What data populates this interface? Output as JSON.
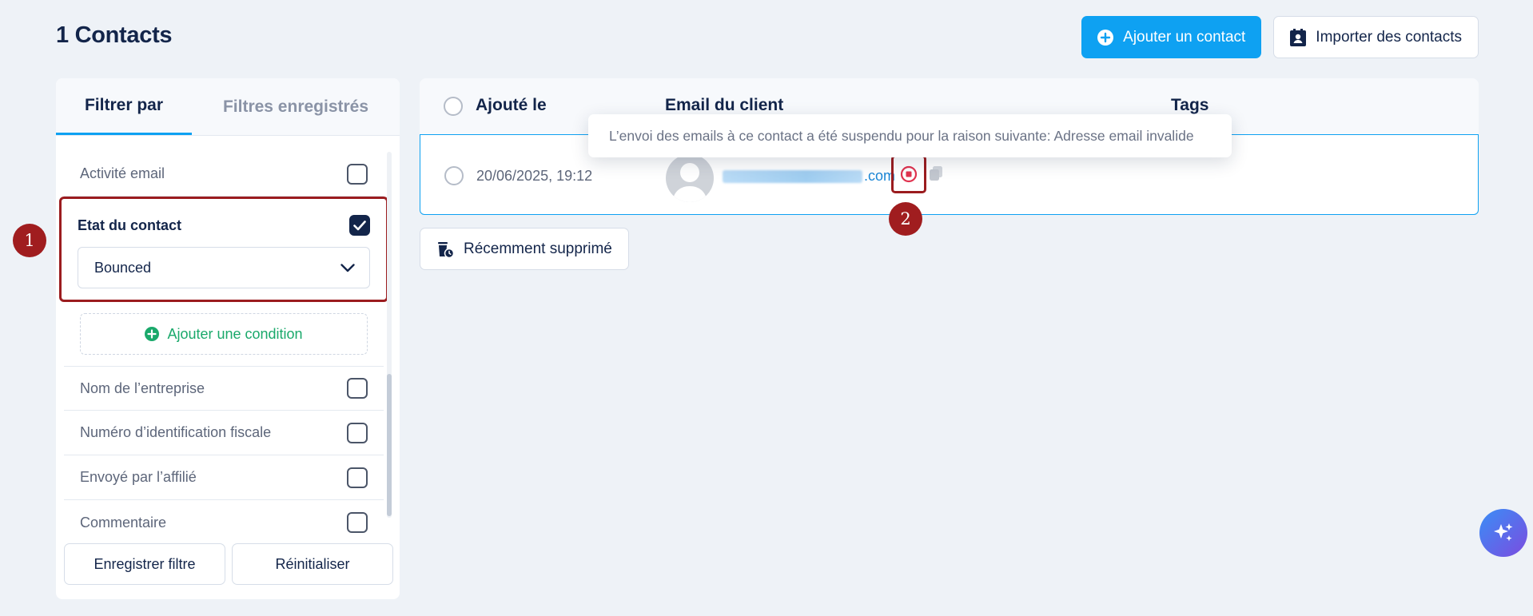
{
  "page": {
    "title": "1 Contacts"
  },
  "toolbar": {
    "add_contact": "Ajouter un contact",
    "import_contacts": "Importer des contacts"
  },
  "filters": {
    "tabs": [
      "Filtrer par",
      "Filtres enregistrés"
    ],
    "email_activity": "Activité email",
    "contact_state": {
      "label": "Etat du contact",
      "checked": true,
      "selected": "Bounced"
    },
    "add_condition": "Ajouter une condition",
    "items": [
      "Nom de l’entreprise",
      "Numéro d’identification fiscale",
      "Envoyé par l’affilié",
      "Commentaire"
    ],
    "save_filter": "Enregistrer filtre",
    "reset": "Réinitialiser"
  },
  "markers": [
    "1",
    "2"
  ],
  "table": {
    "columns": [
      "Ajouté le",
      "Email du client",
      "Tags"
    ],
    "rows": [
      {
        "added": "20/06/2025, 19:12",
        "email_suffix": ".com"
      }
    ]
  },
  "tooltip": "L’envoi des emails à ce contact a été suspendu pour la raison suivante: Adresse email invalide",
  "recently_deleted": "Récemment supprimé",
  "colors": {
    "primary": "#0ea1f2",
    "navy": "#13254a",
    "marker": "#a01d1f",
    "success": "#1aa96b",
    "bounce": "#e0334f"
  }
}
